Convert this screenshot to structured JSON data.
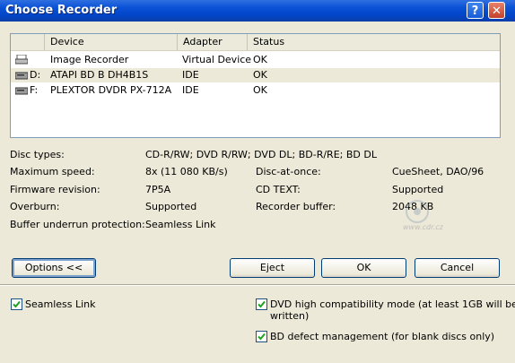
{
  "window": {
    "title": "Choose Recorder",
    "help_glyph": "?",
    "close_glyph": "✕"
  },
  "recorder_list": {
    "columns": [
      "Device",
      "Adapter",
      "Status"
    ],
    "rows": [
      {
        "letter": "",
        "device": "Image Recorder",
        "adapter": "Virtual Device",
        "status": "OK",
        "icon": "image-recorder-icon"
      },
      {
        "letter": "D:",
        "device": "ATAPI BD  B  DH4B1S",
        "adapter": "IDE",
        "status": "OK",
        "icon": "drive-icon"
      },
      {
        "letter": "F:",
        "device": "PLEXTOR DVDR   PX-712A",
        "adapter": "IDE",
        "status": "OK",
        "icon": "drive-icon"
      }
    ]
  },
  "details": {
    "disc_types_label": "Disc types:",
    "disc_types_value": "CD-R/RW; DVD R/RW; DVD DL; BD-R/RE; BD DL",
    "max_speed_label": "Maximum speed:",
    "max_speed_value": "8x (11 080 KB/s)",
    "firmware_label": "Firmware revision:",
    "firmware_value": "7P5A",
    "overburn_label": "Overburn:",
    "overburn_value": "Supported",
    "buffer_protection_label": "Buffer underrun protection:",
    "buffer_protection_value": "Seamless Link",
    "dao_label": "Disc-at-once:",
    "dao_value": "CueSheet, DAO/96",
    "cdtext_label": "CD TEXT:",
    "cdtext_value": "Supported",
    "recorder_buffer_label": "Recorder buffer:",
    "recorder_buffer_value": "2048 KB"
  },
  "watermark": {
    "text": "www.cdr.cz"
  },
  "buttons": {
    "options": "Options <<",
    "eject": "Eject",
    "ok": "OK",
    "cancel": "Cancel"
  },
  "options_panel": {
    "seamless_link": {
      "label": "Seamless Link",
      "checked": true
    },
    "dvd_compat": {
      "label_line1": "DVD high compatibility mode (at least 1GB will be",
      "label_line2": "written)",
      "checked": true
    },
    "bd_defect": {
      "label": "BD defect management (for blank discs only)",
      "checked": true
    }
  },
  "colors": {
    "titlebar": "#0a52d6",
    "face": "#ece9d8",
    "checkmark": "#21a121"
  }
}
